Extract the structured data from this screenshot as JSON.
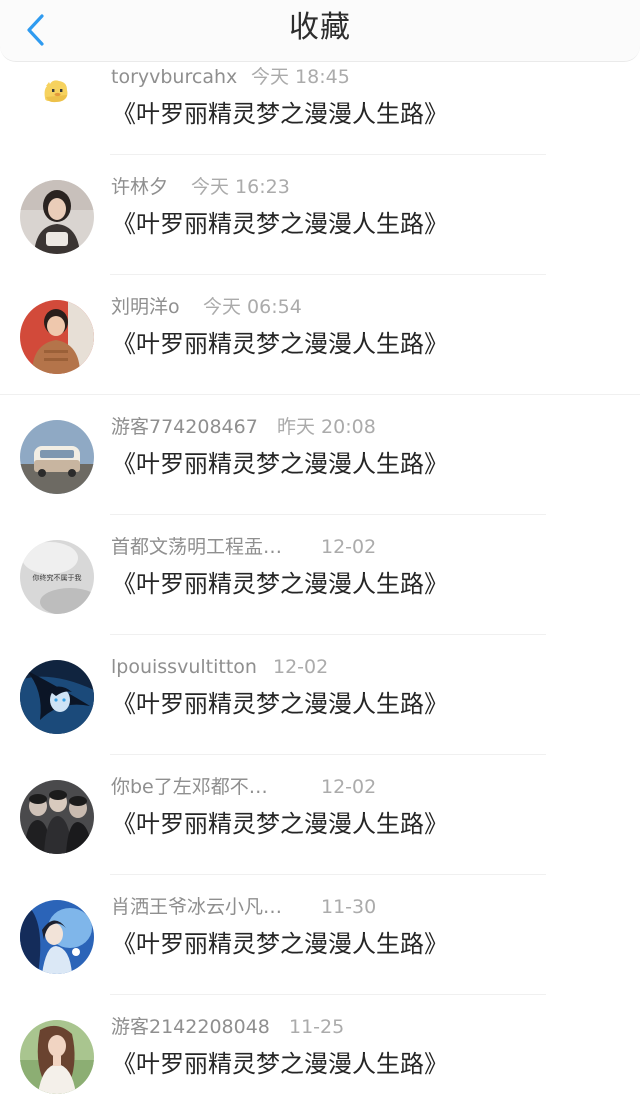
{
  "header": {
    "title": "收藏",
    "back_icon": "chevron-left-icon",
    "accent": "#2f9bf0"
  },
  "items": [
    {
      "name": "toryvburcahx",
      "time": "今天 18:45",
      "title": "《叶罗丽精灵梦之漫漫人生路》",
      "avatar": "duck-emoji-icon"
    },
    {
      "name": "许林夕",
      "time": "今天 16:23",
      "title": "《叶罗丽精灵梦之漫漫人生路》",
      "avatar": "avatar-photo-woman"
    },
    {
      "name": "刘明洋o",
      "time": "今天 06:54",
      "title": "《叶罗丽精灵梦之漫漫人生路》",
      "avatar": "avatar-photo-man"
    },
    {
      "name": "游客774208467",
      "time": "昨天 20:08",
      "title": "《叶罗丽精灵梦之漫漫人生路》",
      "avatar": "avatar-photo-van"
    },
    {
      "name": "首都文荡明工程盂…",
      "time": "12-02",
      "title": "《叶罗丽精灵梦之漫漫人生路》",
      "avatar": "avatar-text-image",
      "avatar_text": "你终究不属于我"
    },
    {
      "name": "lpouissvultitton",
      "time": "12-02",
      "title": "《叶罗丽精灵梦之漫漫人生路》",
      "avatar": "avatar-anime-girl"
    },
    {
      "name": "你be了左邓都不…",
      "time": "12-02",
      "title": "《叶罗丽精灵梦之漫漫人生路》",
      "avatar": "avatar-group-photo"
    },
    {
      "name": "肖洒王爷冰云小凡…",
      "time": "11-30",
      "title": "《叶罗丽精灵梦之漫漫人生路》",
      "avatar": "avatar-anime-blue"
    },
    {
      "name": "游客2142208048",
      "time": "11-25",
      "title": "《叶罗丽精灵梦之漫漫人生路》",
      "avatar": "avatar-photo-girl"
    }
  ]
}
